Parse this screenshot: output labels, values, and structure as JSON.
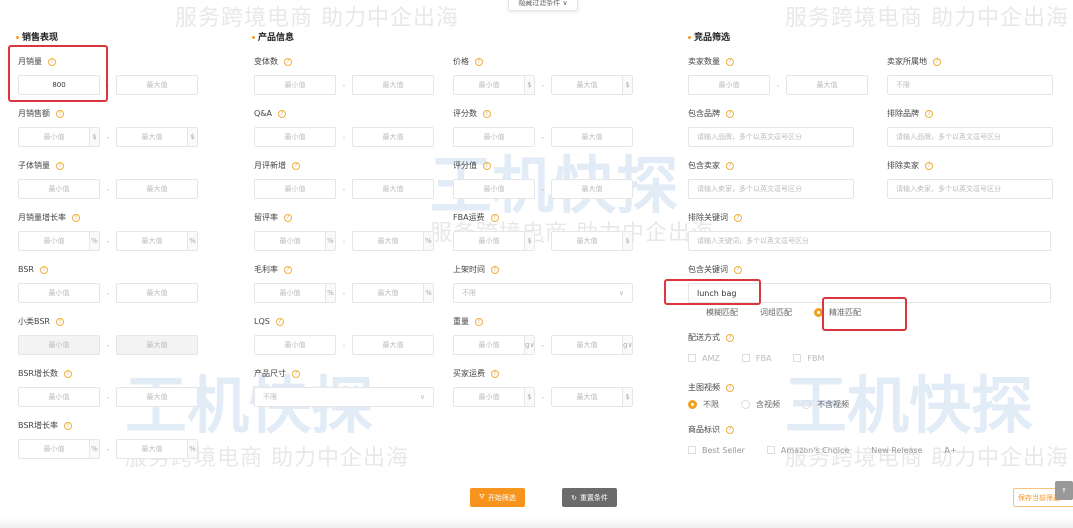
{
  "watermark": {
    "slogan": "服务跨境电商 助力中企出海",
    "logo": "王机快探"
  },
  "toggle_label": "隐藏过滤条件 ∨",
  "sections": {
    "sales": "销售表现",
    "product": "产品信息",
    "competitor": "竞品筛选"
  },
  "columns": [
    {
      "key": "sales",
      "fields": [
        {
          "label": "月销量",
          "type": "range",
          "min_value": "800",
          "max": "最大值"
        },
        {
          "label": "月销售额",
          "type": "range",
          "unit": "$",
          "min": "最小值",
          "max": "最大值"
        },
        {
          "label": "子体销量",
          "type": "range",
          "min": "最小值",
          "max": "最大值"
        },
        {
          "label": "月销量增长率",
          "type": "range",
          "unit": "%",
          "min": "最小值",
          "max": "最大值"
        },
        {
          "label": "BSR",
          "type": "range",
          "min": "最小值",
          "max": "最大值"
        },
        {
          "label": "小类BSR",
          "type": "range",
          "disabled": true,
          "min": "最小值",
          "max": "最大值"
        },
        {
          "label": "BSR增长数",
          "type": "range",
          "min": "最小值",
          "max": "最大值"
        },
        {
          "label": "BSR增长率",
          "type": "range",
          "unit": "%",
          "min": "最小值",
          "max": "最大值"
        }
      ]
    },
    {
      "key": "product_a",
      "fields": [
        {
          "label": "变体数",
          "type": "range",
          "min": "最小值",
          "max": "最大值"
        },
        {
          "label": "Q&A",
          "type": "range",
          "min": "最小值",
          "max": "最大值"
        },
        {
          "label": "月评新增",
          "type": "range",
          "min": "最小值",
          "max": "最大值"
        },
        {
          "label": "留评率",
          "type": "range",
          "unit": "%",
          "min": "最小值",
          "max": "最大值"
        },
        {
          "label": "毛利率",
          "type": "range",
          "unit": "%",
          "min": "最小值",
          "max": "最大值"
        },
        {
          "label": "LQS",
          "type": "range",
          "min": "最小值",
          "max": "最大值"
        },
        {
          "label": "产品尺寸",
          "type": "select",
          "value": "不限"
        }
      ]
    },
    {
      "key": "product_b",
      "fields": [
        {
          "label": "价格",
          "type": "range",
          "unit": "$",
          "min": "最小值",
          "max": "最大值"
        },
        {
          "label": "评分数",
          "type": "range",
          "min": "最小值",
          "max": "最大值"
        },
        {
          "label": "评分值",
          "type": "range",
          "min": "最小值",
          "max": "最大值"
        },
        {
          "label": "FBA运费",
          "type": "range",
          "unit": "$",
          "min": "最小值",
          "max": "最大值"
        },
        {
          "label": "上架时间",
          "type": "select",
          "value": "不限"
        },
        {
          "label": "重量",
          "type": "range",
          "unit": "g∨",
          "min": "最小值",
          "max": "最大值"
        },
        {
          "label": "买家运费",
          "type": "range",
          "unit": "$",
          "min": "最小值",
          "max": "最大值"
        }
      ]
    },
    {
      "key": "comp_a",
      "fields": [
        {
          "label": "卖家数量",
          "type": "range",
          "min": "最小值",
          "max": "最大值"
        },
        {
          "label": "包含品牌",
          "type": "text",
          "placeholder": "请输入品牌，多个以英文逗号区分"
        },
        {
          "label": "包含卖家",
          "type": "text",
          "placeholder": "请输入卖家，多个以英文逗号区分"
        },
        {
          "label": "排除关键词",
          "type": "text",
          "wide": true,
          "placeholder": "请输入关键词，多个以英文逗号区分"
        },
        {
          "label": "包含关键词",
          "type": "text",
          "wide": true,
          "value": "lunch bag"
        }
      ]
    },
    {
      "key": "comp_b",
      "fields": [
        {
          "label": "卖家所属地",
          "type": "text",
          "placeholder": "不限"
        },
        {
          "label": "排除品牌",
          "type": "text",
          "placeholder": "请输入品牌，多个以英文逗号区分"
        },
        {
          "label": "排除卖家",
          "type": "text",
          "placeholder": "请输入卖家，多个以英文逗号区分"
        }
      ]
    }
  ],
  "keyword_match": {
    "options": [
      "模糊匹配",
      "词组匹配",
      "精准匹配"
    ],
    "selected": "精准匹配"
  },
  "delivery": {
    "label": "配送方式",
    "options": [
      "AMZ",
      "FBA",
      "FBM"
    ]
  },
  "video": {
    "label": "主图视频",
    "options": [
      "不限",
      "含视频",
      "不含视频"
    ],
    "selected": "不限"
  },
  "badges": {
    "label": "商品标识",
    "options": [
      "Best Seller",
      "Amazon's Choice",
      "New Release",
      "A+"
    ]
  },
  "buttons": {
    "start": "开始筛选",
    "reset": "重置条件",
    "save": "保存当前筛选"
  },
  "colors": {
    "accent": "#f7941d",
    "highlight": "#d9363e",
    "reset": "#6b6b6b"
  }
}
